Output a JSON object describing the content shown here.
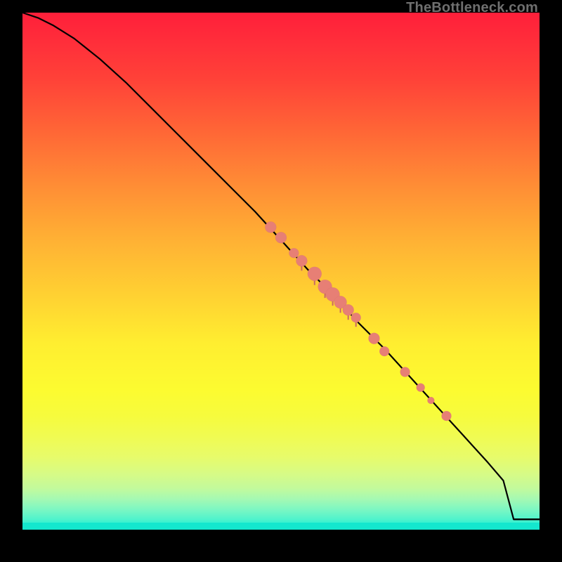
{
  "watermark": "TheBottleneck.com",
  "colors": {
    "dot": "#e77f75",
    "curve": "#000000",
    "gradient_top": "#ff1f3a",
    "gradient_bottom": "#19efd7"
  },
  "chart_data": {
    "type": "line",
    "title": "",
    "xlabel": "",
    "ylabel": "",
    "xlim": [
      0,
      100
    ],
    "ylim": [
      0,
      100
    ],
    "grid": false,
    "legend": false,
    "series": [
      {
        "name": "curve",
        "x": [
          0,
          3,
          6,
          10,
          15,
          20,
          25,
          30,
          35,
          40,
          45,
          50,
          55,
          60,
          65,
          70,
          75,
          80,
          85,
          90,
          93,
          95,
          100
        ],
        "y": [
          100,
          99,
          97.5,
          95,
          91,
          86.5,
          81.5,
          76.5,
          71.5,
          66.5,
          61.5,
          56,
          50.5,
          45.5,
          40,
          35,
          29.5,
          24,
          18.5,
          13,
          9.5,
          2,
          2
        ]
      }
    ],
    "points": [
      {
        "x": 48,
        "y": 58.5,
        "r": 8
      },
      {
        "x": 50,
        "y": 56.5,
        "r": 8
      },
      {
        "x": 52.5,
        "y": 53.5,
        "r": 7
      },
      {
        "x": 54,
        "y": 52,
        "r": 8
      },
      {
        "x": 56.5,
        "y": 49.5,
        "r": 10
      },
      {
        "x": 58.5,
        "y": 47,
        "r": 10
      },
      {
        "x": 60,
        "y": 45.5,
        "r": 10
      },
      {
        "x": 61.5,
        "y": 44,
        "r": 9
      },
      {
        "x": 63,
        "y": 42.5,
        "r": 8
      },
      {
        "x": 64.5,
        "y": 41,
        "r": 7
      },
      {
        "x": 68,
        "y": 37,
        "r": 8
      },
      {
        "x": 70,
        "y": 34.5,
        "r": 7
      },
      {
        "x": 74,
        "y": 30.5,
        "r": 7
      },
      {
        "x": 77,
        "y": 27.5,
        "r": 6
      },
      {
        "x": 79,
        "y": 25,
        "r": 5
      },
      {
        "x": 82,
        "y": 22,
        "r": 7
      }
    ]
  }
}
